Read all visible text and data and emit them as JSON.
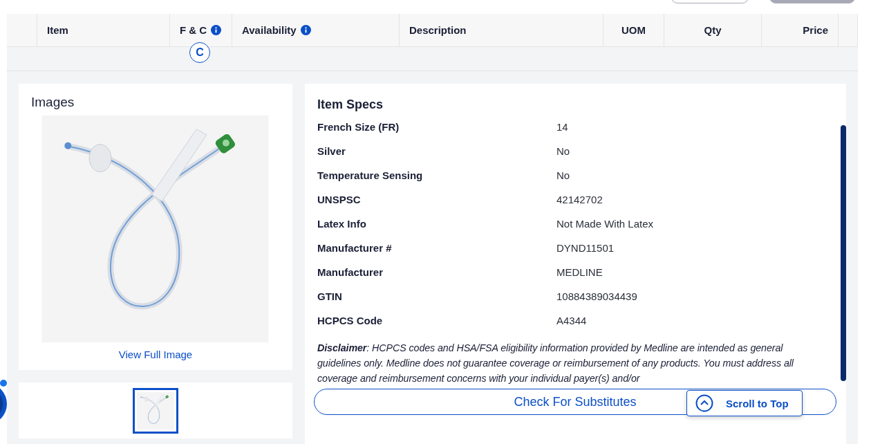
{
  "table": {
    "columns": [
      {
        "info": false
      },
      {
        "label": "Item",
        "info": false
      },
      {
        "label": "F & C",
        "info": true
      },
      {
        "label": "Availability",
        "info": true
      },
      {
        "label": "Description",
        "info": false
      },
      {
        "label": "UOM",
        "info": false
      },
      {
        "label": "Qty",
        "info": false
      },
      {
        "label": "Price",
        "info": false
      },
      {
        "info": false
      }
    ],
    "row_badge": "C"
  },
  "images": {
    "title": "Images",
    "link": "View Full Image",
    "main": {
      "kind": "picture"
    },
    "thumbnails": [
      {
        "kind": "picture",
        "selected": true
      }
    ]
  },
  "specs": {
    "title": "Item Specs",
    "rows": [
      {
        "label": "French Size (FR)",
        "value": "14"
      },
      {
        "label": "Silver",
        "value": "No"
      },
      {
        "label": "Temperature Sensing",
        "value": "No"
      },
      {
        "label": "UNSPSC",
        "value": "42142702"
      },
      {
        "label": "Latex Info",
        "value": "Not Made With Latex"
      },
      {
        "label": "Manufacturer #",
        "value": "DYND11501"
      },
      {
        "label": "Manufacturer",
        "value": "MEDLINE"
      },
      {
        "label": "GTIN",
        "value": "10884389034439"
      },
      {
        "label": "HCPCS Code",
        "value": "A4344"
      }
    ],
    "disclaimer": "**Disclaimer**: HCPCS codes and HSA/FSA eligibility information provided by Medline are intended as general guidelines only. Medline does not guarantee coverage or reimbursement of any products. You must address all coverage and reimbursement concerns with your individual payer(s) and/or",
    "button": "Check For Substitutes"
  },
  "scroll_to_top": "Scroll to Top"
}
